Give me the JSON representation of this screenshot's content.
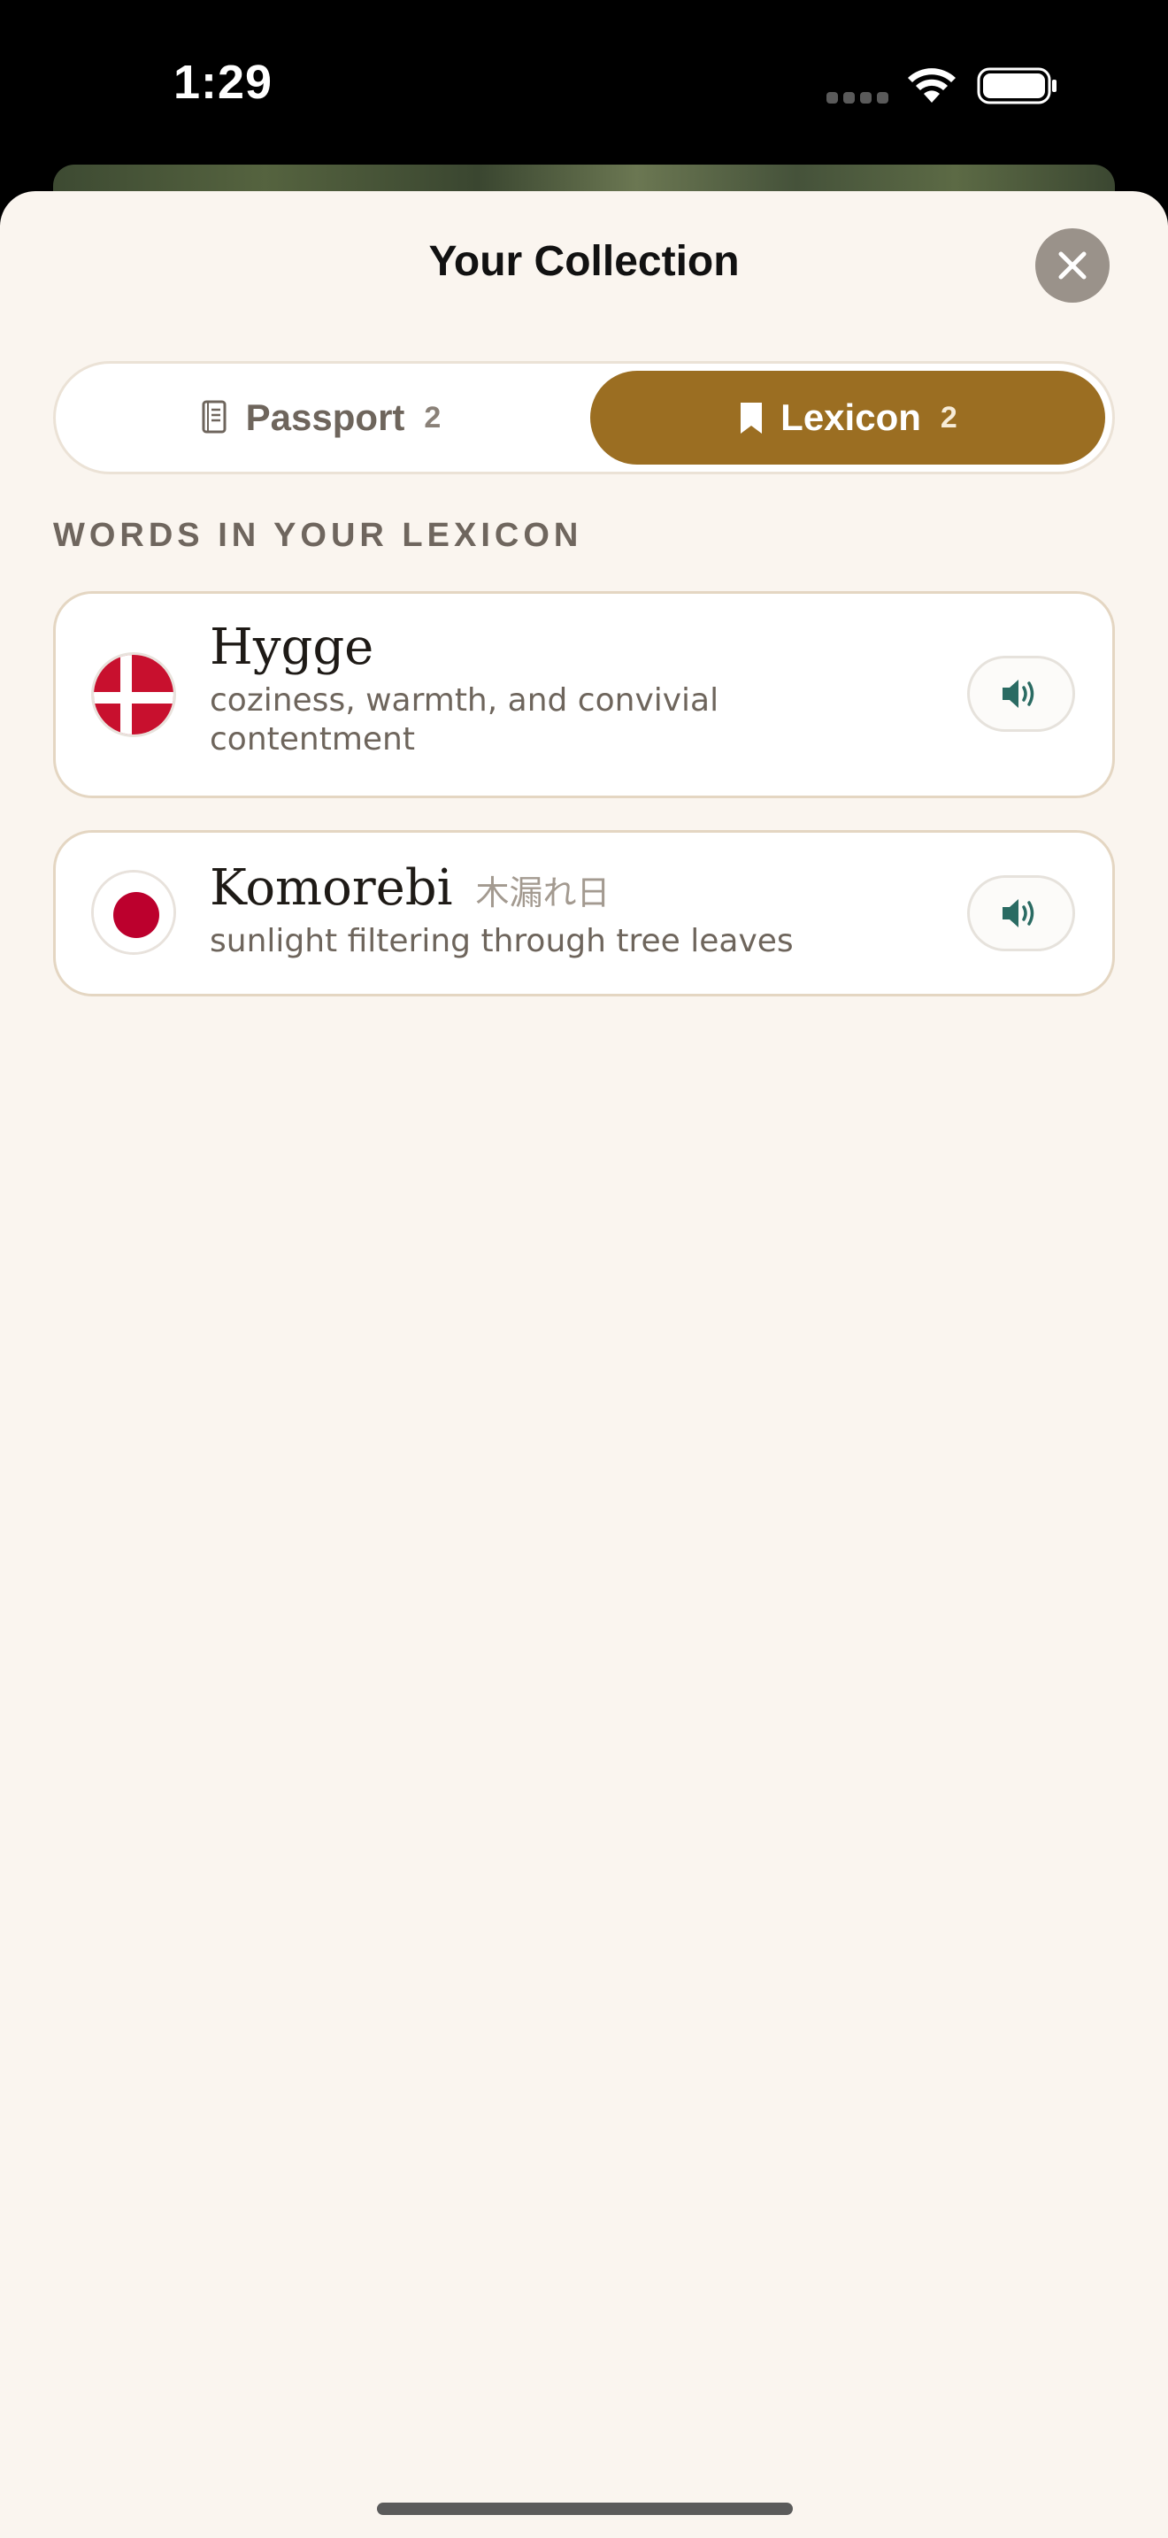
{
  "status_bar": {
    "time": "1:29"
  },
  "sheet": {
    "title": "Your Collection",
    "close_icon": "close-icon"
  },
  "tabs": [
    {
      "label": "Passport",
      "count": "2",
      "icon": "passport-icon",
      "selected": false
    },
    {
      "label": "Lexicon",
      "count": "2",
      "icon": "bookmark-icon",
      "selected": true
    }
  ],
  "section_heading": "WORDS IN YOUR LEXICON",
  "words": [
    {
      "word": "Hygge",
      "native": "",
      "meaning": "coziness, warmth, and convivial contentment",
      "flag": "denmark-flag",
      "audio_icon": "speaker-icon"
    },
    {
      "word": "Komorebi",
      "native": "木漏れ日",
      "meaning": "sunlight filtering through tree leaves",
      "flag": "japan-flag",
      "audio_icon": "speaker-icon"
    }
  ],
  "colors": {
    "accent": "#9b6e22",
    "sheet_background": "#faf5ef",
    "speaker": "#2a6b63",
    "danish_red": "#c8102e",
    "japan_red": "#bc002d"
  }
}
